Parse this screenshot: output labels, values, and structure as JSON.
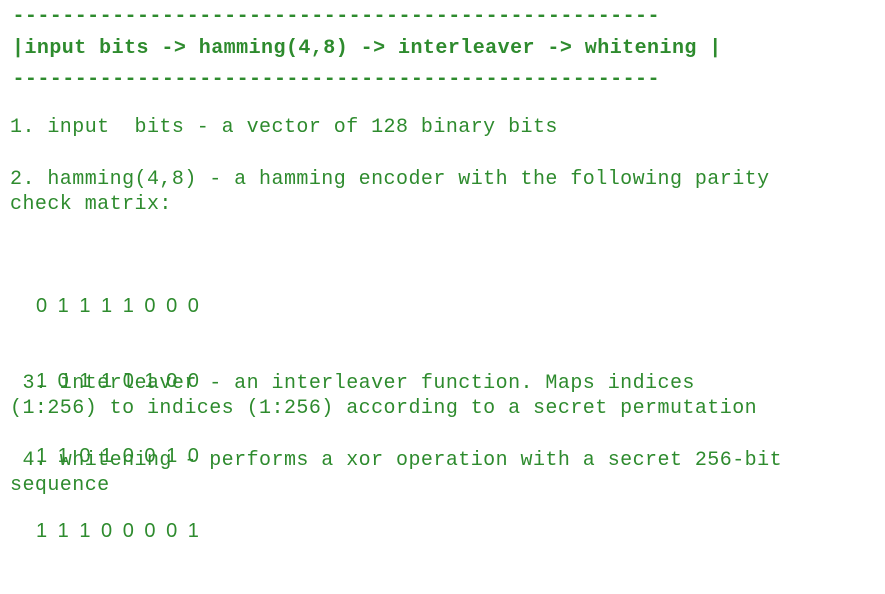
{
  "header": {
    "rule_top": " ----------------------------------------------------",
    "pipeline": "|input bits -> hamming(4,8) -> interleaver -> whitening |",
    "rule_bottom": " ----------------------------------------------------"
  },
  "items": [
    {
      "line1": "1. input  bits - a vector of 128 binary bits"
    },
    {
      "line1": "2. hamming(4,8) - a hamming encoder with the following parity",
      "line2": "check matrix:"
    },
    {
      "line1": " 3. interleaver - an interleaver function. Maps indices",
      "line2": "(1:256) to indices (1:256) according to a secret permutation"
    },
    {
      "line1": " 4. whitening - performs a xor operation with a secret 256-bit",
      "line2": "sequence"
    }
  ],
  "matrix": {
    "rows": [
      "0 1 1 1 1 0 0 0",
      "1 0 1 1 0 1 0 0",
      "1 1 0 1 0 0 1 0",
      "1 1 1 0 0 0 0 1"
    ]
  },
  "colors": {
    "text": "#2e8b2e",
    "background": "#ffffff"
  }
}
